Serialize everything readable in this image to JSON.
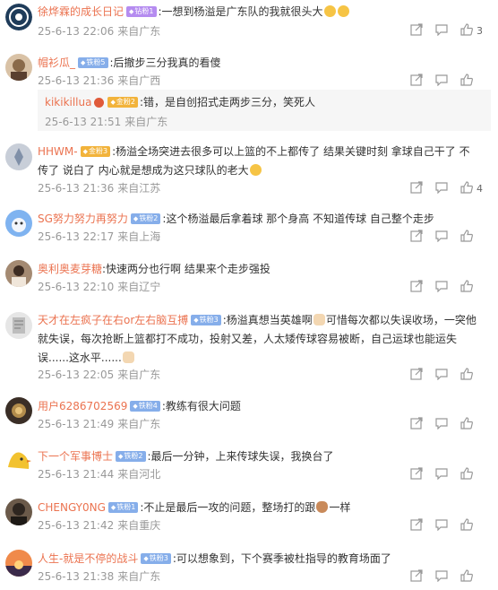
{
  "comments": [
    {
      "username": "徐烨霖的成长日记",
      "name_color": "#eb7350",
      "badge": {
        "label": "钻粉1",
        "style": "purple"
      },
      "text": ":一想到杨溢是广东队的我就很头大",
      "emojis": [
        "sweat-grin-emoji",
        "sweat-grin-emoji"
      ],
      "time": "25-6-13 22:06",
      "source": "来自广东",
      "likes": "3",
      "avatar_color": "#3b5e7a"
    },
    {
      "username": "帽衫瓜_",
      "name_color": "#eb7350",
      "badge": {
        "label": "铁粉5",
        "style": "blue"
      },
      "text": ":后撤步三分我真的看傻",
      "time": "25-6-13 21:36",
      "source": "来自广西",
      "likes": "",
      "avatar_color": "#8a6a4a",
      "reply": {
        "username": "kikikillua",
        "name_color": "#eb7350",
        "badge": {
          "label": "金粉2",
          "style": "gold"
        },
        "text": ":错，是自创招式走两步三分，笑死人",
        "time": "25-6-13 21:51",
        "source": "来自广东"
      }
    },
    {
      "username": "HHWM-",
      "name_color": "#eb7350",
      "badge": {
        "label": "金粉3",
        "style": "gold"
      },
      "text": ":杨溢全场突进去很多可以上篮的不上都传了 结果关键时刻 拿球自己干了 不传了 说白了 内心就是想成为这只球队的老大",
      "text_emoji": "smirk-emoji",
      "time": "25-6-13 21:36",
      "source": "来自江苏",
      "likes": "4",
      "avatar_color": "#9aa6b8"
    },
    {
      "username": "SG努力努力再努力",
      "name_color": "#eb7350",
      "badge": {
        "label": "铁粉2",
        "style": "blue"
      },
      "text": ":这个杨溢最后拿着球 那个身高 不知道传球 自己整个走步",
      "time": "25-6-13 22:17",
      "source": "来自上海",
      "likes": "",
      "avatar_color": "#5b8fd6"
    },
    {
      "username": "奥利奥麦芽糖",
      "name_color": "#eb7350",
      "badge": null,
      "text": ":快速两分也行啊 结果来个走步强投",
      "time": "25-6-13 22:10",
      "source": "来自辽宁",
      "likes": "",
      "avatar_color": "#7a5a46"
    },
    {
      "username": "天才在左疯子在右or左右脑互搏",
      "name_color": "#eb7350",
      "badge": {
        "label": "铁粉3",
        "style": "blue"
      },
      "text_parts": [
        ":杨溢真想当英雄啊",
        "可惜每次都以失误收场，一突他就失误，每次抢断上篮都打不成功，投射又差，人太矮传球容易被断，自己运球也能运失误......这水平......"
      ],
      "time": "25-6-13 22:05",
      "source": "来自广东",
      "likes": "",
      "avatar_color": "#c9c9c9"
    },
    {
      "username": "用户6286702569",
      "name_color": "#eb7350",
      "badge": {
        "label": "铁粉4",
        "style": "blue"
      },
      "text": ":教练有很大问题",
      "time": "25-6-13 21:49",
      "source": "来自广东",
      "likes": "",
      "avatar_color": "#4a3b2e"
    },
    {
      "username": "下一个军事博士",
      "name_color": "#eb7350",
      "badge": {
        "label": "铁粉2",
        "style": "blue"
      },
      "text": ":最后一分钟，上来传球失误，我换台了",
      "time": "25-6-13 21:44",
      "source": "来自河北",
      "likes": "",
      "avatar_color": "#f2c230"
    },
    {
      "username": "CHENGY0NG",
      "name_color": "#eb7350",
      "badge": {
        "label": "铁粉1",
        "style": "blue"
      },
      "text_parts": [
        ":不止是最后一攻的问题，整场打的跟",
        "一样"
      ],
      "time": "25-6-13 21:42",
      "source": "来自重庆",
      "likes": "",
      "avatar_color": "#3a3a3a"
    },
    {
      "username": "人生-就是不停的战斗",
      "name_color": "#eb7350",
      "badge": {
        "label": "铁粉3",
        "style": "blue"
      },
      "text": ":可以想象到，下个赛季被杜指导的教育场面了",
      "time": "25-6-13 21:38",
      "source": "来自广东",
      "likes": "",
      "avatar_color": "#d8572a"
    }
  ],
  "colors": {
    "accent": "#eb7350",
    "meta": "#999999",
    "reply_bg": "#f6f6f6"
  },
  "icons": [
    "share-icon",
    "comment-icon",
    "like-icon"
  ]
}
